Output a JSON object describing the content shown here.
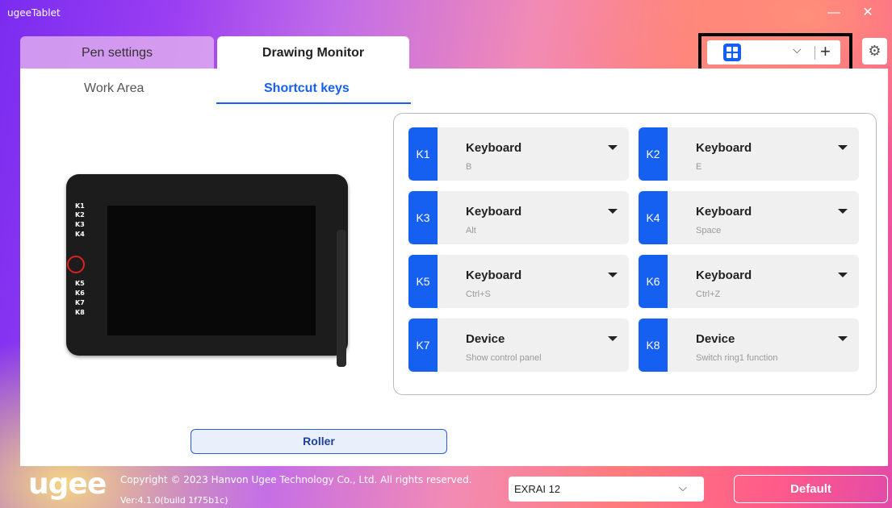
{
  "window": {
    "title": "ugeeTablet",
    "minimize_icon": "minimize-icon",
    "close_icon": "close-icon"
  },
  "top_tabs": [
    {
      "label": "Pen settings",
      "selected": false
    },
    {
      "label": "Drawing Monitor",
      "selected": true
    }
  ],
  "profile": {
    "icon": "grid-icon",
    "value": "",
    "dropdown_icon": "chevron-down-icon",
    "add_icon": "plus-icon"
  },
  "settings_icon": "gear-icon",
  "sub_tabs": [
    {
      "label": "Work Area",
      "selected": false
    },
    {
      "label": "Shortcut keys",
      "selected": true
    }
  ],
  "tablet_keys": [
    "K1",
    "K2",
    "K3",
    "K4",
    "K5",
    "K6",
    "K7",
    "K8"
  ],
  "shortcut_keys": [
    {
      "tag": "K1",
      "type": "Keyboard",
      "value": "B"
    },
    {
      "tag": "K2",
      "type": "Keyboard",
      "value": "E"
    },
    {
      "tag": "K3",
      "type": "Keyboard",
      "value": "Alt"
    },
    {
      "tag": "K4",
      "type": "Keyboard",
      "value": "Space"
    },
    {
      "tag": "K5",
      "type": "Keyboard",
      "value": "Ctrl+S"
    },
    {
      "tag": "K6",
      "type": "Keyboard",
      "value": "Ctrl+Z"
    },
    {
      "tag": "K7",
      "type": "Device",
      "value": "Show control panel"
    },
    {
      "tag": "K8",
      "type": "Device",
      "value": "Switch ring1 function"
    }
  ],
  "roller_label": "Roller",
  "footer": {
    "logo": "ugee",
    "copyright": "Copyright © 2023 Hanvon Ugee Technology Co., Ltd. All rights reserved.",
    "version": "Ver:4.1.0(build 1f75b1c)",
    "device": "EXRAI 12",
    "default_label": "Default"
  },
  "colors": {
    "accent": "#1560f0",
    "ring": "#e02020"
  }
}
